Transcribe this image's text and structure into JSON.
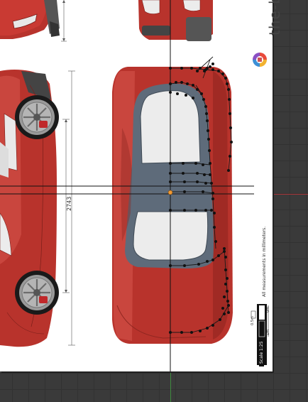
{
  "blueprint": {
    "brand_text": "the-b",
    "measurement_note": "All measurements in millimeters.",
    "dimension_label": "2743",
    "scale_label": "Scale 1:25",
    "scale_marks": [
      "0.5m",
      "1m",
      "0m"
    ]
  },
  "colors": {
    "viewport_bg": "#3a3a3a",
    "grid_line": "#323232",
    "axis_red": "#a8353a",
    "axis_green": "#3f8a3f",
    "car_body": "#b8332c",
    "car_shadow": "#8e2620",
    "cabin": "#5e6b7a",
    "glass": "#ececec",
    "vertex": "#111111",
    "selected_vertex": "#f39a33"
  },
  "icons": {
    "brand_logo": "colorful-b-logo-icon",
    "origin": "3d-cursor-origin-icon"
  }
}
